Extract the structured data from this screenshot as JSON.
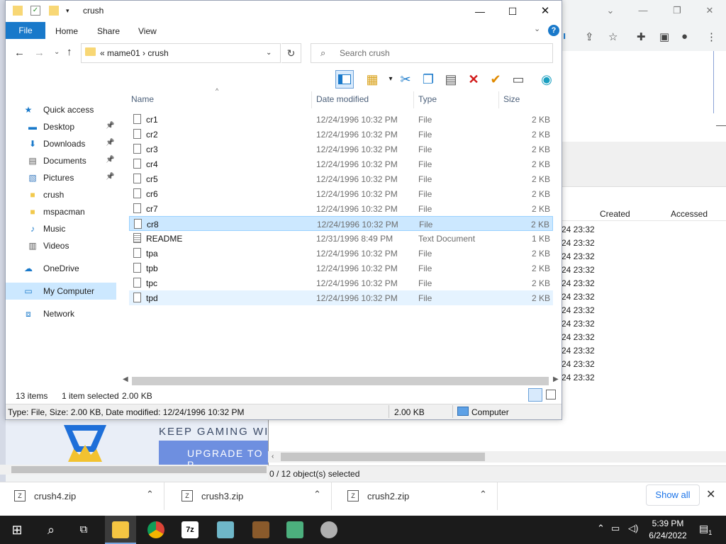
{
  "explorer": {
    "title": "crush",
    "ribbon_tabs": [
      "File",
      "Home",
      "Share",
      "View"
    ],
    "help": "?",
    "address": {
      "parts": [
        "«",
        "mame01",
        "›",
        "crush"
      ],
      "text": "«  mame01  ›  crush"
    },
    "search_placeholder": "Search crush",
    "nav_pane": [
      {
        "label": "Quick access",
        "icon": "star-icon",
        "pinned": false
      },
      {
        "label": "Desktop",
        "icon": "desktop-icon",
        "pinned": true
      },
      {
        "label": "Downloads",
        "icon": "download-icon",
        "pinned": true
      },
      {
        "label": "Documents",
        "icon": "documents-icon",
        "pinned": true
      },
      {
        "label": "Pictures",
        "icon": "pictures-icon",
        "pinned": true
      },
      {
        "label": "crush",
        "icon": "folder-icon",
        "pinned": false
      },
      {
        "label": "mspacman",
        "icon": "folder-icon",
        "pinned": false
      },
      {
        "label": "Music",
        "icon": "music-icon",
        "pinned": false
      },
      {
        "label": "Videos",
        "icon": "videos-icon",
        "pinned": false
      },
      {
        "label": "OneDrive",
        "icon": "cloud-icon",
        "pinned": false
      },
      {
        "label": "My Computer",
        "icon": "computer-icon",
        "pinned": false,
        "selected": true
      },
      {
        "label": "Network",
        "icon": "network-icon",
        "pinned": false
      }
    ],
    "columns": [
      "Name",
      "Date modified",
      "Type",
      "Size"
    ],
    "files": [
      {
        "name": "cr1",
        "date": "12/24/1996 10:32 PM",
        "type": "File",
        "size": "2 KB"
      },
      {
        "name": "cr2",
        "date": "12/24/1996 10:32 PM",
        "type": "File",
        "size": "2 KB"
      },
      {
        "name": "cr3",
        "date": "12/24/1996 10:32 PM",
        "type": "File",
        "size": "2 KB"
      },
      {
        "name": "cr4",
        "date": "12/24/1996 10:32 PM",
        "type": "File",
        "size": "2 KB"
      },
      {
        "name": "cr5",
        "date": "12/24/1996 10:32 PM",
        "type": "File",
        "size": "2 KB"
      },
      {
        "name": "cr6",
        "date": "12/24/1996 10:32 PM",
        "type": "File",
        "size": "2 KB"
      },
      {
        "name": "cr7",
        "date": "12/24/1996 10:32 PM",
        "type": "File",
        "size": "2 KB"
      },
      {
        "name": "cr8",
        "date": "12/24/1996 10:32 PM",
        "type": "File",
        "size": "2 KB",
        "selected": true
      },
      {
        "name": "README",
        "date": "12/31/1996 8:49 PM",
        "type": "Text Document",
        "size": "1 KB"
      },
      {
        "name": "tpa",
        "date": "12/24/1996 10:32 PM",
        "type": "File",
        "size": "2 KB"
      },
      {
        "name": "tpb",
        "date": "12/24/1996 10:32 PM",
        "type": "File",
        "size": "2 KB"
      },
      {
        "name": "tpc",
        "date": "12/24/1996 10:32 PM",
        "type": "File",
        "size": "2 KB"
      },
      {
        "name": "tpd",
        "date": "12/24/1996 10:32 PM",
        "type": "File",
        "size": "2 KB",
        "hover": true
      }
    ],
    "count_bar": {
      "items": "13 items",
      "selected": "1 item selected",
      "selected_size": "2.00 KB"
    },
    "status_bar": {
      "info": "Type: File, Size: 2.00 KB, Date modified: 12/24/1996 10:32 PM",
      "size": "2.00 KB",
      "location": "Computer"
    }
  },
  "sevenzip": {
    "columns": [
      "Created",
      "Accessed"
    ],
    "row_values": [
      "24 23:32",
      "24 23:32",
      "24 23:32",
      "24 23:32",
      "24 23:32",
      "24 23:32",
      "24 23:32",
      "24 23:32",
      "24 23:32",
      "24 23:32",
      "24 23:32",
      "24 23:32"
    ],
    "status": "0 / 12 object(s) selected"
  },
  "web_banner": {
    "text": "KEEP GAMING WI",
    "button": "UPGRADE TO P"
  },
  "downloads": {
    "items": [
      "crush4.zip",
      "crush3.zip",
      "crush2.zip"
    ],
    "show_all": "Show all"
  },
  "taskbar": {
    "time": "5:39 PM",
    "date": "6/24/2022",
    "notifications": "1"
  }
}
